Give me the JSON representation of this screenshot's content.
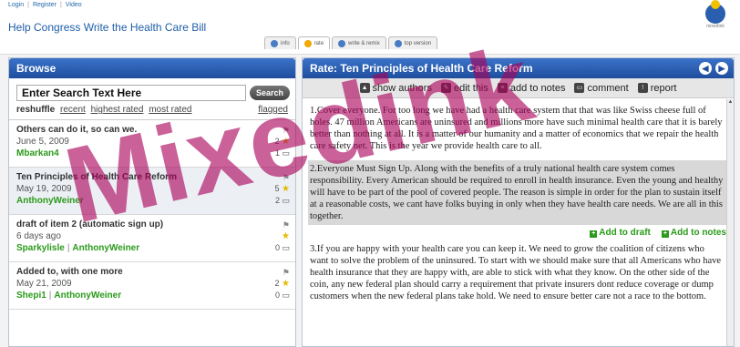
{
  "header": {
    "links": [
      "Login",
      "Register",
      "Video"
    ],
    "app_title": "Help Congress Write the Health Care Bill",
    "tabs": [
      {
        "label": "info",
        "icon": "info-icon"
      },
      {
        "label": "rate",
        "icon": "rate-icon"
      },
      {
        "label": "write & remix",
        "icon": "write-icon"
      },
      {
        "label": "top version",
        "icon": "top-version-icon"
      }
    ],
    "logo_text": "mixedink"
  },
  "browse": {
    "title": "Browse",
    "search_value": "Enter Search Text Here",
    "search_button": "Search",
    "sort_label": "reshuffle",
    "sort_links": [
      "recent",
      "highest rated",
      "most rated"
    ],
    "flagged": "flagged",
    "items": [
      {
        "title": "Others can do it, so can we.",
        "date": "June 5, 2009",
        "authors": [
          "Mbarkan4"
        ],
        "rating": "2",
        "comments": "1"
      },
      {
        "title": "Ten Principles of Health Care Reform",
        "date": "May 19, 2009",
        "authors": [
          "AnthonyWeiner"
        ],
        "rating": "5",
        "comments": "2"
      },
      {
        "title": "draft of item 2 (automatic sign up)",
        "date": "6 days ago",
        "authors": [
          "Sparkylisle",
          "AnthonyWeiner"
        ],
        "rating": "",
        "comments": "0"
      },
      {
        "title": "Added to, with one more",
        "date": "May 21, 2009",
        "authors": [
          "Shepi1",
          "AnthonyWeiner"
        ],
        "rating": "2",
        "comments": "0"
      }
    ]
  },
  "rate": {
    "title": "Rate: Ten Principles of Health Care Reform",
    "toolbar": [
      "show authors",
      "edit this",
      "add to notes",
      "comment",
      "report"
    ],
    "paragraphs": [
      "1.Cover everyone.  For too long we have had a health care system that that was like Swiss cheese  full of holes. 47 million Americans are uninsured and millions more have such minimal health care that it is barely better than nothing at all.  It is a matter of our humanity and a matter of economics that we repair the health care safety net.  This is the year we provide health care to all.",
      "2.Everyone Must Sign Up.  Along with the benefits of a truly national health care system comes responsibility.  Every American should be required to enroll in health insurance.  Even the young and healthy will have to be part of the pool of covered people.  The reason is simple  in order for the plan to sustain itself at a reasonable costs, we cant have folks buying in only when they have health care needs.  We are all in this together.",
      "3.If you are happy with your health care  you can keep it.  We need to grow the coalition of citizens who want to solve the problem of the uninsured.  To start with we should make sure that all Americans who have health insurance that they are happy with, are able to stick with what they know.  On the other side of the coin, any new federal plan should carry a requirement that private insurers dont reduce coverage or dump customers when the new federal plans take hold.  We need to ensure better care not a race to the bottom."
    ],
    "para_actions": [
      "Add to draft",
      "Add to notes"
    ]
  },
  "watermark": "Mixedink"
}
